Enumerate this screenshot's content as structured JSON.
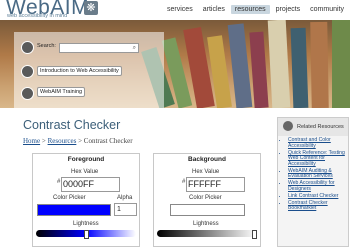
{
  "site": {
    "logo_text": "WebAIM",
    "tagline": "web accessibility in mind"
  },
  "nav": {
    "items": [
      {
        "label": "services",
        "active": false
      },
      {
        "label": "articles",
        "active": false
      },
      {
        "label": "resources",
        "active": true
      },
      {
        "label": "projects",
        "active": false
      },
      {
        "label": "community",
        "active": false
      }
    ]
  },
  "hero": {
    "search_label": "Search:",
    "search_value": "",
    "link_intro": "Introduction to Web Accessibility",
    "link_training": "WebAIM Training"
  },
  "page": {
    "title": "Contrast Checker",
    "breadcrumb": {
      "home": "Home",
      "sep1": ">",
      "resources": "Resources",
      "sep2": ">",
      "current": "Contrast Checker"
    }
  },
  "foreground": {
    "title": "Foreground",
    "hex_label": "Hex Value",
    "hash": "#",
    "hex_value": "0000FF",
    "picker_label": "Color Picker",
    "picker_color": "#0000FF",
    "alpha_label": "Alpha",
    "alpha_value": "1",
    "lightness_label": "Lightness",
    "lightness_level": 0.5
  },
  "background": {
    "title": "Background",
    "hex_label": "Hex Value",
    "hash": "#",
    "hex_value": "FFFFFF",
    "picker_label": "Color Picker",
    "picker_color": "#FFFFFF",
    "lightness_label": "Lightness",
    "lightness_level": 1.0
  },
  "sidebar": {
    "title": "Related Resources",
    "links": [
      "Contrast and Color Accessibility",
      "Quick Reference: Testing Web Content for Accessibility",
      "WebAIM Auditing & Evaluation Services",
      "Web Accessibility for Designers",
      "Link Contrast Checker",
      "Contrast Checker Bookmarklet"
    ]
  }
}
